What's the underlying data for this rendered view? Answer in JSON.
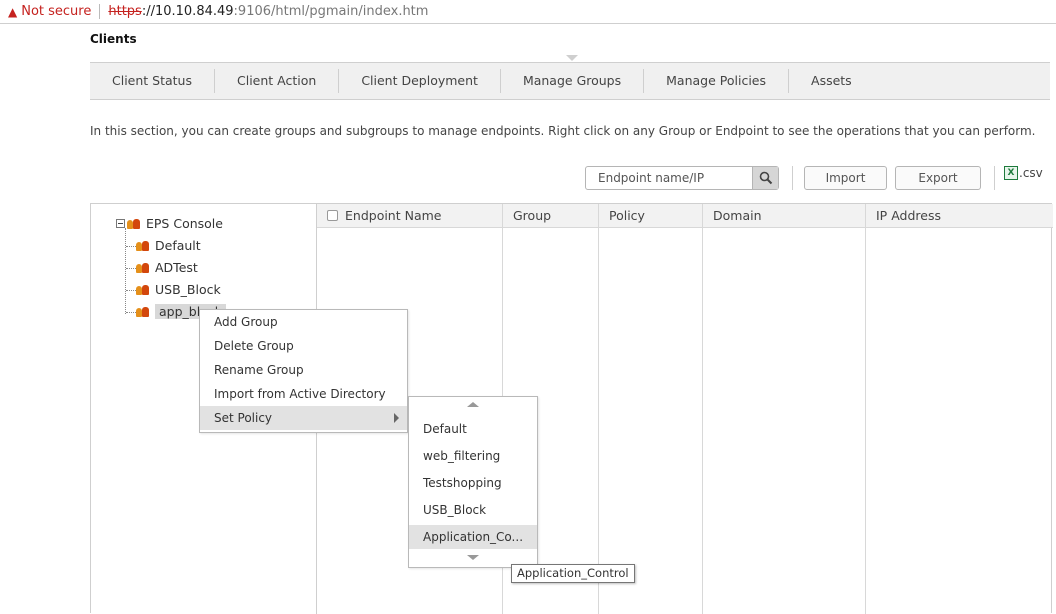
{
  "browser": {
    "security_label": "Not secure",
    "url_scheme": "https",
    "url_host": "://10.10.84.49",
    "url_path": ":9106/html/pgmain/index.htm"
  },
  "page_title": "Clients",
  "tabs": [
    {
      "label": "Client Status"
    },
    {
      "label": "Client Action"
    },
    {
      "label": "Client Deployment"
    },
    {
      "label": "Manage Groups"
    },
    {
      "label": "Manage Policies"
    },
    {
      "label": "Assets"
    }
  ],
  "description": "In this section, you can create groups and subgroups to manage endpoints. Right click on any Group or Endpoint to see the operations that you can perform.",
  "search": {
    "placeholder": "Endpoint name/IP"
  },
  "toolbar": {
    "import_label": "Import",
    "export_label": "Export",
    "csv_label": ".csv",
    "csv_icon_letter": "X"
  },
  "tree": {
    "root": "EPS Console",
    "children": [
      "Default",
      "ADTest",
      "USB_Block",
      "app_block"
    ]
  },
  "table": {
    "columns": [
      "Endpoint Name",
      "Group",
      "Policy",
      "Domain",
      "IP Address"
    ]
  },
  "context_menu": {
    "items": [
      "Add Group",
      "Delete Group",
      "Rename Group",
      "Import from Active Directory",
      "Set Policy"
    ]
  },
  "policy_submenu": {
    "items": [
      "Default",
      "web_filtering",
      "Testshopping",
      "USB_Block",
      "Application_Co..."
    ]
  },
  "tooltip": "Application_Control"
}
